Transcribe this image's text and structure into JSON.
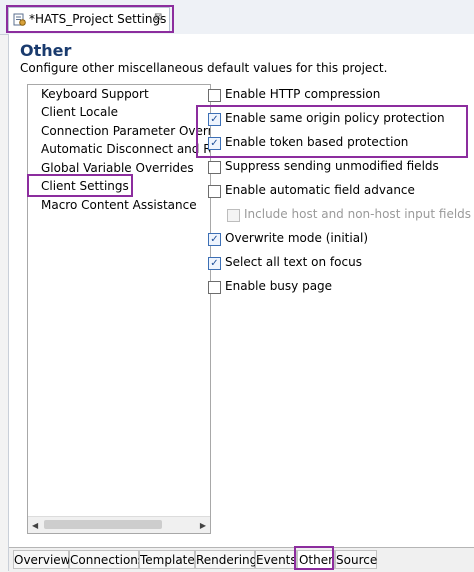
{
  "editor": {
    "tab_title": "*HATS_Project Settings",
    "close_glyph": "⊠",
    "tab_icon": "settings-file-icon"
  },
  "page": {
    "title": "Other",
    "description": "Configure other miscellaneous default values for this project."
  },
  "nav": {
    "items": [
      {
        "label": "Keyboard Support"
      },
      {
        "label": "Client Locale"
      },
      {
        "label": "Connection Parameter Overric"
      },
      {
        "label": "Automatic Disconnect and Re"
      },
      {
        "label": "Global Variable Overrides"
      },
      {
        "label": "Client Settings",
        "selected": true
      },
      {
        "label": "Macro Content Assistance"
      }
    ]
  },
  "options": [
    {
      "label": "Enable HTTP compression",
      "checked": false
    },
    {
      "label": "Enable same origin policy protection",
      "checked": true
    },
    {
      "label": "Enable token based protection",
      "checked": true
    },
    {
      "label": "Suppress sending unmodified fields",
      "checked": false
    },
    {
      "label": "Enable automatic field advance",
      "checked": false
    },
    {
      "label": "Include host and non-host input fields",
      "checked": false,
      "disabled": true
    },
    {
      "label": "Overwrite mode (initial)",
      "checked": true
    },
    {
      "label": "Select all text on focus",
      "checked": true
    },
    {
      "label": "Enable busy page",
      "checked": false
    }
  ],
  "bottom_tabs": [
    {
      "label": "Overview"
    },
    {
      "label": "Connections"
    },
    {
      "label": "Template"
    },
    {
      "label": "Rendering"
    },
    {
      "label": "Events"
    },
    {
      "label": "Other",
      "active": true
    },
    {
      "label": "Source"
    }
  ],
  "colors": {
    "highlight": "#8c2d9e",
    "title": "#1a3b6e",
    "checkbox_checked": "#1f4f99"
  }
}
